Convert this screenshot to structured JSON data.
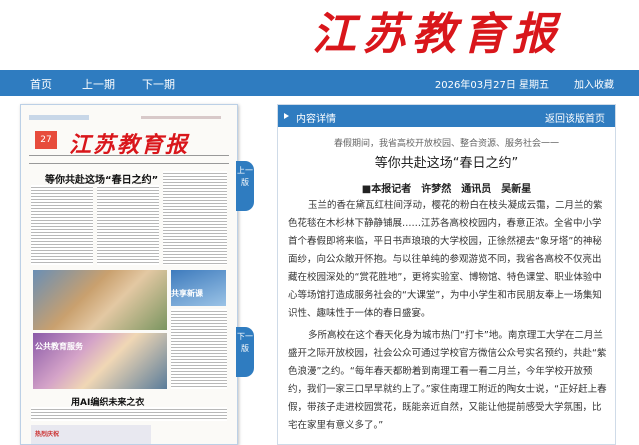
{
  "masthead": {
    "logo": "江苏教育报"
  },
  "nav": {
    "home": "首页",
    "prev": "上一期",
    "next": "下一期",
    "date": "2026年03月27日 星期五",
    "favorite": "加入收藏"
  },
  "paper": {
    "logo": "江苏教育报",
    "date_badge": "27",
    "headline": "等你共赴这场“春日之约”",
    "photo_label": "共享新课",
    "photo2_label": "公共教育服务",
    "ai_headline": "用AI编织未来之衣",
    "bottom_ad": "热烈庆祝"
  },
  "side_tabs": {
    "prev_page": "上一版",
    "next_page": "下一版"
  },
  "detail": {
    "header": "内容详情",
    "back": "返回该版首页",
    "kicker": "春假期间，我省高校开放校园、整合资源、服务社会一一",
    "title": "等你共赴这场“春日之约”",
    "byline": "■本报记者　许梦然　通讯员　吴新星",
    "paragraphs": [
      "玉兰的香在黛瓦红柱间浮动，樱花的粉白在枝头凝成云霭，二月兰的紫色花毯在木杉林下静静铺展……江苏各高校校园内，春意正浓。全省中小学首个春假即将来临，平日书声琅琅的大学校园，正徐然褪去“象牙塔”的神秘面纱，向公众敞开怀抱。与以往单纯的参观游览不同，我省各高校不仅亮出藏在校园深处的“赏花胜地”，更将实验室、博物馆、特色课堂、职业体验中心等场馆打造成服务社会的“大课堂”，为中小学生和市民朋友奉上一场集知识性、趣味性于一体的春日盛宴。",
      "多所高校在这个春天化身为城市热门“打卡”地。南京理工大学在二月兰盛开之际开放校园，社会公众可通过学校官方微信公众号实名预约，共赴“紫色浪漫”之约。“每年春天都盼着到南理工看一看二月兰，今年学校开放预约，我们一家三口早早就约上了。”家住南理工附近的陶女士说，“正好赶上春假，带孩子走进校园赏花，既能亲近自然，又能让他提前感受大学氛围，比宅在家里有意义多了。”"
    ]
  }
}
